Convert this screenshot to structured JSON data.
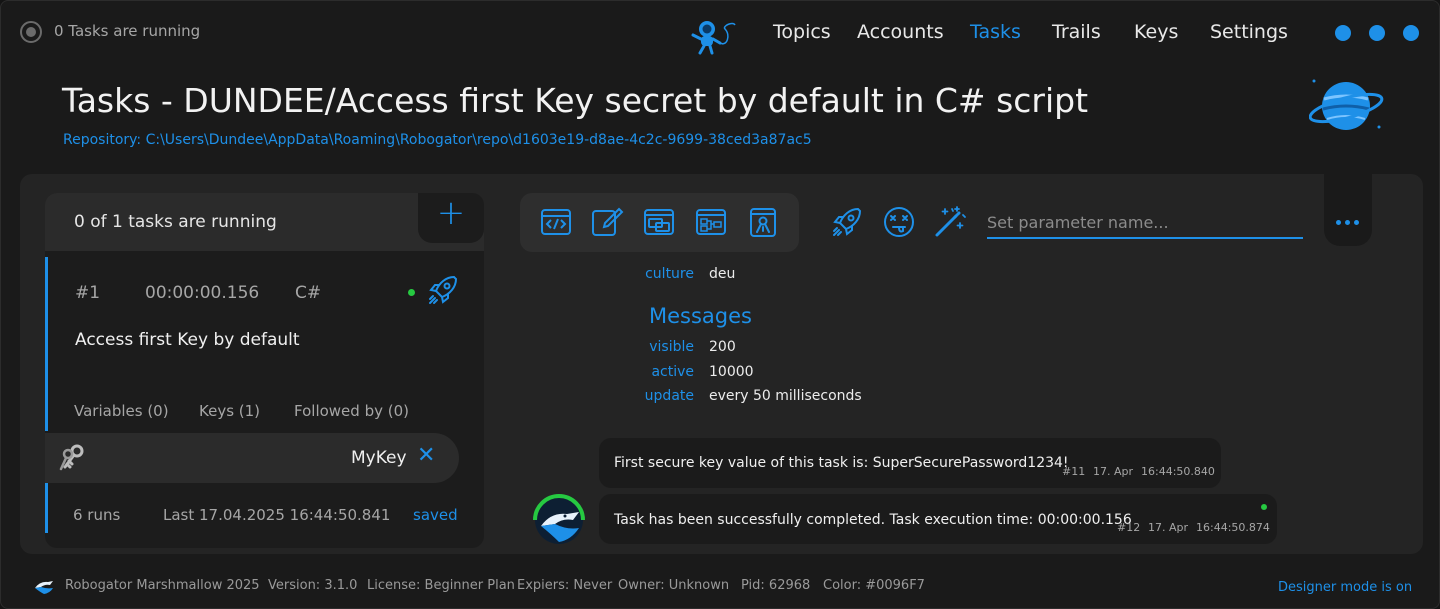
{
  "topbar": {
    "status_text": "0 Tasks are running",
    "nav": [
      "Topics",
      "Accounts",
      "Tasks",
      "Trails",
      "Keys",
      "Settings"
    ],
    "active_nav": "Tasks"
  },
  "header": {
    "title": "Tasks - DUNDEE/Access first Key secret by default in C# script",
    "repository": "Repository: C:\\Users\\Dundee\\AppData\\Roaming\\Robogator\\repo\\d1603e19-d8ae-4c2c-9699-38ced3a87ac5"
  },
  "tasks_panel": {
    "running_text": "0 of 1 tasks are running",
    "add_label": "+",
    "task": {
      "number": "#1",
      "elapsed": "00:00:00.156",
      "language": "C#",
      "name": "Access first Key by default",
      "tabs": [
        "Variables (0)",
        "Keys (1)",
        "Followed by (0)"
      ]
    },
    "key": {
      "name": "MyKey",
      "remove": "✕"
    },
    "runs": {
      "count": "6 runs",
      "last": "Last 17.04.2025 16:44:50.841",
      "state": "saved"
    }
  },
  "parameter": {
    "placeholder": "Set parameter name..."
  },
  "details": {
    "culture_key": "culture",
    "culture_val": "deu",
    "messages_title": "Messages",
    "visible_key": "visible",
    "visible_val": "200",
    "active_key": "active",
    "active_val": "10000",
    "update_key": "update",
    "update_val": "every 50 milliseconds"
  },
  "messages": [
    {
      "text": "First secure key value of this task is: SuperSecurePassword1234!",
      "id": "#11",
      "date": "17. Apr",
      "time": "16:44:50.840"
    },
    {
      "text": "Task has been successfully completed. Task execution time: 00:00:00.156",
      "id": "#12",
      "date": "17. Apr",
      "time": "16:44:50.874"
    }
  ],
  "footer": {
    "product": "Robogator Marshmallow 2025",
    "version": "Version: 3.1.0",
    "license": "License: Beginner Plan",
    "expires": "Expiers: Never",
    "owner": "Owner: Unknown",
    "pid": "Pid: 62968",
    "color": "Color: #0096F7",
    "designer": "Designer mode is on"
  },
  "colors": {
    "accent": "#1e90e8",
    "status_green": "#26c941",
    "background": "#1a1a1a"
  }
}
